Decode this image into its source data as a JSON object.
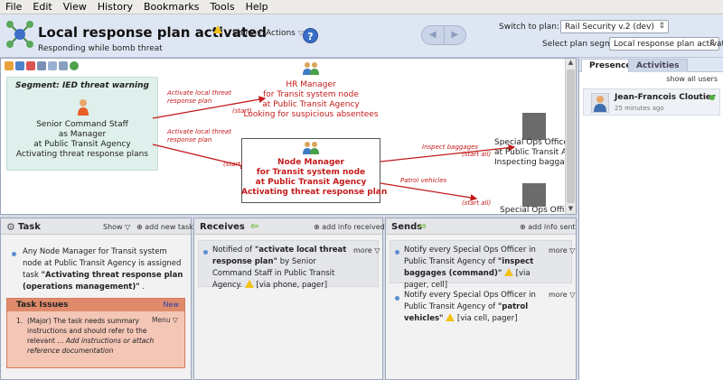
{
  "menu": [
    "File",
    "Edit",
    "View",
    "History",
    "Bookmarks",
    "Tools",
    "Help"
  ],
  "header": {
    "title": "Local response plan activated",
    "subtitle": "Responding while bomb threat",
    "show_label": "Show",
    "actions_label": "Actions",
    "help_label": "?",
    "switch_plan_label": "Switch to plan:",
    "plan_value": "Rail Security v.2 (dev)",
    "segment_label": "Select plan segment:",
    "segment_value": "Local response plan activated"
  },
  "map": {
    "segment_title": "Segment: IED threat warning",
    "nodes": {
      "senior": [
        "Senior Command Staff",
        "as Manager",
        "at Public Transit Agency",
        "Activating threat response plans"
      ],
      "hr": [
        "HR Manager",
        "for Transit system node",
        "at Public Transit Agency",
        "Looking for suspicious absentees"
      ],
      "node_manager": [
        "Node Manager",
        "for Transit system node",
        "at Public Transit Agency",
        "Activating threat response plan"
      ],
      "special_ops": [
        "Special Ops Office",
        "at Public Transit Age",
        "Inspecting baggage"
      ],
      "special_ops_2": [
        "Special Ops Office"
      ]
    },
    "edges": {
      "e1_label": [
        "Activate local threat",
        "response plan"
      ],
      "e1_start": "(start)",
      "e2_label": [
        "Activate local threat",
        "response plan"
      ],
      "e2_start": "(start)",
      "e3_label": "Inspect baggages",
      "e3_start": "(start all)",
      "e4_label": "Patrol vehicles",
      "e4_start": "(start all)"
    }
  },
  "presence": {
    "tabs": [
      "Presence",
      "Activities"
    ],
    "show_all": "show all users",
    "user_name": "Jean-Francois Cloutier",
    "user_time": "25 minutes ago"
  },
  "task_panel": {
    "title": "Task",
    "show_label": "Show",
    "add_label": "add new task",
    "text_plain": "Any Node Manager for Transit system node at Public Transit Agency is assigned task",
    "text_bold": "\"Activating threat response plan (operations management)\"",
    "text_end": ".",
    "issues_title": "Task Issues",
    "issues_new": "New",
    "issue_num": "1.",
    "issue_text": "(Major) The task needs summary instructions and should refer to the relevant ...",
    "issue_menu": "Menu",
    "issue_hint": "Add instructions or attach reference documentation"
  },
  "receives_panel": {
    "title": "Receives",
    "add_label": "add info received",
    "more": "more",
    "text_a": "Notified of",
    "text_bold": "\"activate local threat response plan\"",
    "text_b": "by Senior Command Staff in Public Transit Agency.",
    "via": "[via phone, pager]"
  },
  "sends_panel": {
    "title": "Sends",
    "add_label": "add info sent",
    "item1_more": "more",
    "item1_a": "Notify every Special Ops Officer in Public Transit Agency of",
    "item1_bold": "\"inspect baggages (command)\"",
    "item1_via": "[via pager, cell]",
    "item2_more": "more",
    "item2_a": "Notify every Special Ops Officer in Public Transit Agency of",
    "item2_bold": "\"patrol vehicles\"",
    "item2_via": "[via cell, pager]"
  },
  "colors": {
    "accent_red": "#c41a1a",
    "link_blue": "#2b43a8",
    "online": "#52b043"
  }
}
